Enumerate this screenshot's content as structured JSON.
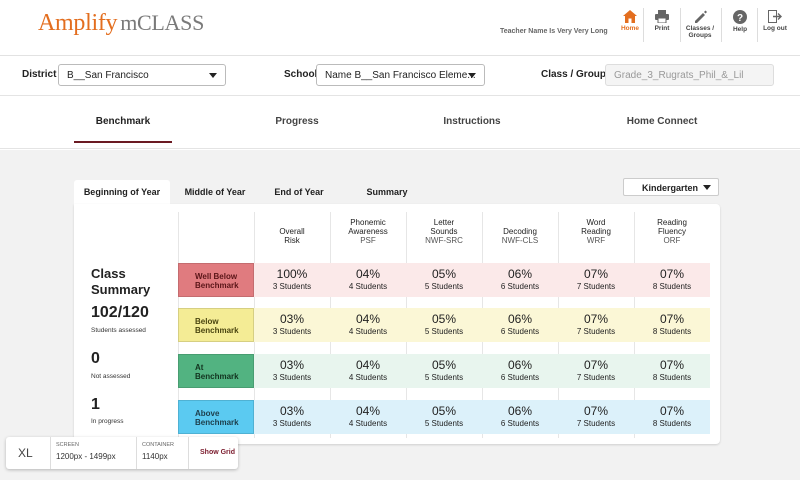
{
  "app": {
    "brand": "Amplify",
    "product": "mCLASS",
    "brand_color": "#e36e1f"
  },
  "header": {
    "teacher_name": "Teacher Name Is Very Very Long",
    "nav": [
      {
        "label": "Home",
        "icon": "home-icon",
        "active": true
      },
      {
        "label": "Print",
        "icon": "print-icon",
        "active": false
      },
      {
        "label1": "Classes /",
        "label2": "Groups",
        "icon": "edit-icon",
        "active": false
      },
      {
        "label": "Help",
        "icon": "help-icon",
        "active": false
      },
      {
        "label": "Log out",
        "icon": "logout-icon",
        "active": false
      }
    ]
  },
  "filters": {
    "district_label": "District",
    "district_value": "B__San Francisco",
    "school_label": "School",
    "school_value": "Name B__San Francisco Eleme...",
    "class_label": "Class / Group",
    "class_value": "Grade_3_Rugrats_Phil_&_Lil"
  },
  "main_tabs": [
    "Benchmark",
    "Progress",
    "Instructions",
    "Home Connect"
  ],
  "sub_tabs": [
    "Beginning of Year",
    "Middle of Year",
    "End of Year",
    "Summary"
  ],
  "grade_select": "Kindergarten",
  "summary": {
    "title1": "Class",
    "title2": "Summary",
    "stats": [
      {
        "value": "102/120",
        "label": "Students assessed"
      },
      {
        "value": "0",
        "label": "Not assessed"
      },
      {
        "value": "1",
        "label": "In progress"
      }
    ]
  },
  "columns": [
    {
      "l1": "",
      "l2": "Overall",
      "l3": "Risk"
    },
    {
      "l1": "Phonemic",
      "l2": "Awareness",
      "l3": "PSF"
    },
    {
      "l1": "Letter",
      "l2": "Sounds",
      "l3": "NWF-SRC"
    },
    {
      "l1": "",
      "l2": "Decoding",
      "l3": "NWF-CLS"
    },
    {
      "l1": "Word",
      "l2": "Reading",
      "l3": "WRF"
    },
    {
      "l1": "Reading",
      "l2": "Fluency",
      "l3": "ORF"
    }
  ],
  "rows": [
    {
      "label1": "Well Below",
      "label2": "Benchmark",
      "label_color": "#e07b7f",
      "bg": "#fbe9e9",
      "cells": [
        [
          "100%",
          "3 Students"
        ],
        [
          "04%",
          "4 Students"
        ],
        [
          "05%",
          "5 Students"
        ],
        [
          "06%",
          "6 Students"
        ],
        [
          "07%",
          "7 Students"
        ],
        [
          "07%",
          "8 Students"
        ]
      ]
    },
    {
      "label1": "Below",
      "label2": "Benchmark",
      "label_color": "#f4ec95",
      "bg": "#fbf7d6",
      "cells": [
        [
          "03%",
          "3 Students"
        ],
        [
          "04%",
          "4 Students"
        ],
        [
          "05%",
          "5 Students"
        ],
        [
          "06%",
          "6 Students"
        ],
        [
          "07%",
          "7 Students"
        ],
        [
          "07%",
          "8 Students"
        ]
      ]
    },
    {
      "label1": "At",
      "label2": "Benchmark",
      "label_color": "#52b381",
      "bg": "#e8f5ee",
      "cells": [
        [
          "03%",
          "3 Students"
        ],
        [
          "04%",
          "4 Students"
        ],
        [
          "05%",
          "5 Students"
        ],
        [
          "06%",
          "6 Students"
        ],
        [
          "07%",
          "7 Students"
        ],
        [
          "07%",
          "8 Students"
        ]
      ]
    },
    {
      "label1": "Above",
      "label2": "Benchmark",
      "label_color": "#5bcaf1",
      "bg": "#dcf1fa",
      "cells": [
        [
          "03%",
          "3 Students"
        ],
        [
          "04%",
          "4 Students"
        ],
        [
          "05%",
          "5 Students"
        ],
        [
          "06%",
          "6 Students"
        ],
        [
          "07%",
          "7 Students"
        ],
        [
          "07%",
          "8 Students"
        ]
      ]
    }
  ],
  "breakpoint": {
    "size": "XL",
    "screen_label": "SCREEN",
    "screen_value": "1200px - 1499px",
    "container_label": "CONTAINER",
    "container_value": "1140px",
    "grid_label": "Show Grid"
  }
}
